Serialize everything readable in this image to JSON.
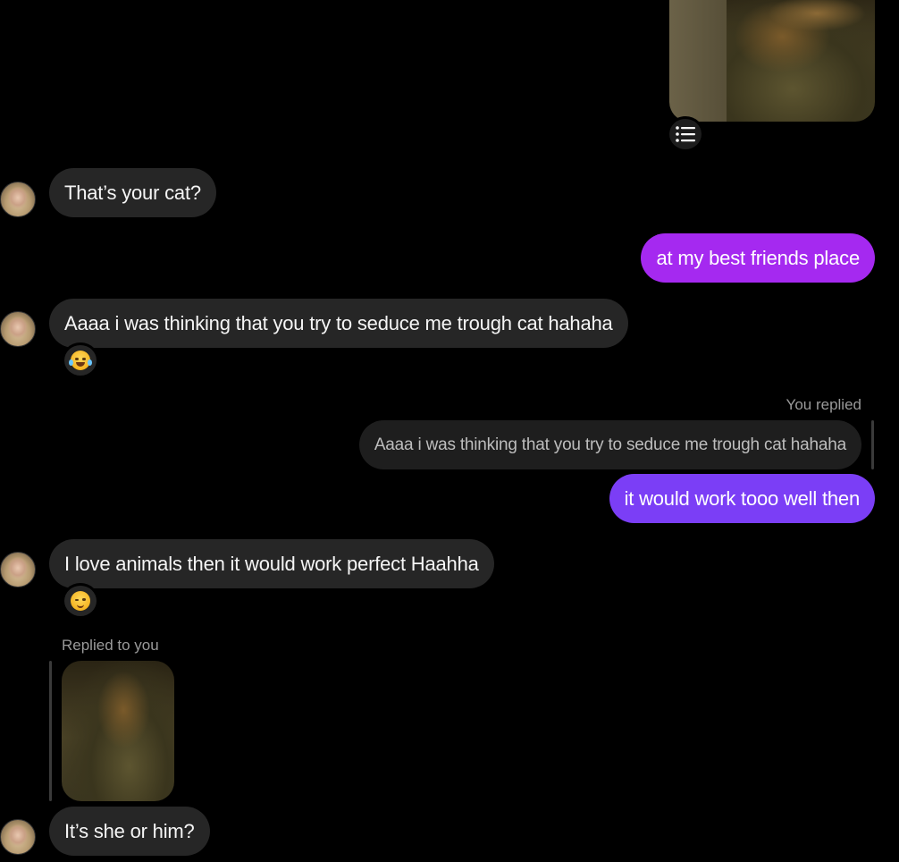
{
  "conversation": {
    "messages": [
      {
        "from": "them",
        "text": "That’s your cat?"
      },
      {
        "from": "me",
        "text": "at my best friends place",
        "color": "#a529f0"
      },
      {
        "from": "them",
        "text": "Aaaa i was thinking that you try to seduce me trough cat hahaha",
        "reaction_icon": "tears-of-joy-emoji-icon"
      },
      {
        "from": "me",
        "reply_label": "You replied",
        "quoted_text": "Aaaa i was thinking that you try to seduce me trough cat hahaha",
        "text": "it would work tooo well then",
        "color": "#7b3ef6"
      },
      {
        "from": "them",
        "text": "I love animals then it would work perfect Haahha",
        "reaction_icon": "winking-face-emoji-icon"
      },
      {
        "from": "them",
        "reply_label": "Replied to you",
        "attachment": "cat-photo"
      },
      {
        "from": "them",
        "text": "It’s she or him?"
      }
    ]
  },
  "colors": {
    "background": "#000000",
    "incoming_bubble": "#262626",
    "outgoing_purple": "#a529f0",
    "outgoing_violet": "#7b3ef6"
  }
}
